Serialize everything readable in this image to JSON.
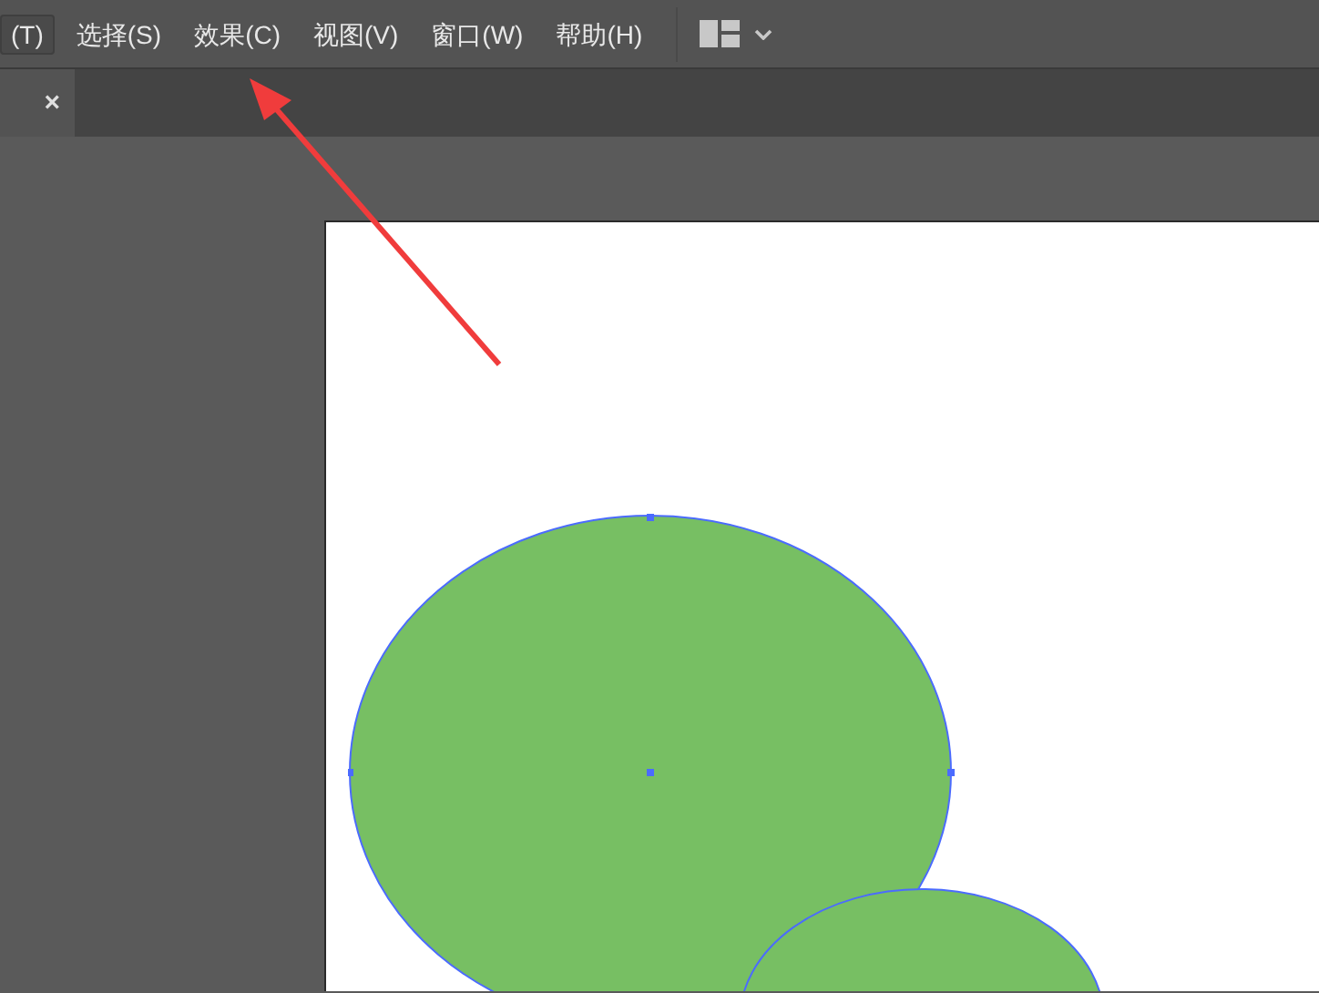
{
  "menu_bar": {
    "items": [
      {
        "label": "(T)",
        "selected": true
      },
      {
        "label": "选择(S)",
        "selected": false
      },
      {
        "label": "效果(C)",
        "selected": false
      },
      {
        "label": "视图(V)",
        "selected": false
      },
      {
        "label": "窗口(W)",
        "selected": false
      },
      {
        "label": "帮助(H)",
        "selected": false
      }
    ]
  },
  "tab_bar": {
    "tabs": [
      {
        "close": "×",
        "selected": true
      }
    ]
  }
}
